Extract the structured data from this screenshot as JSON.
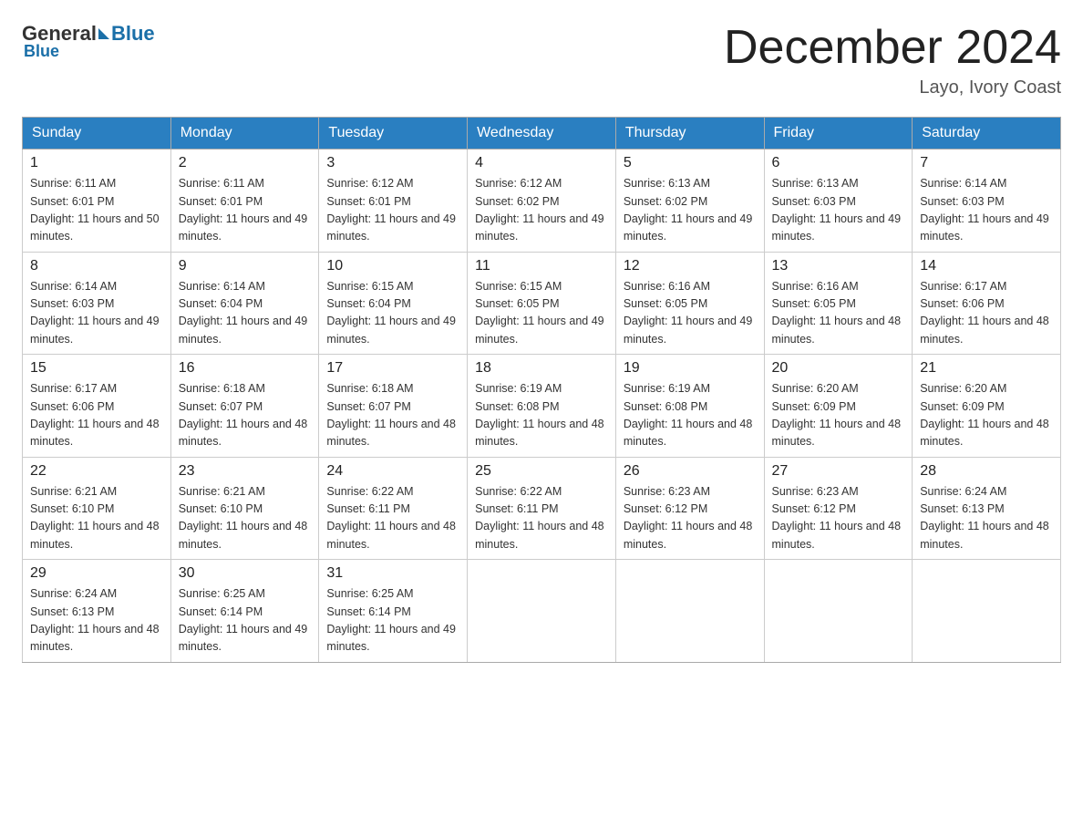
{
  "header": {
    "logo_general": "General",
    "logo_blue": "Blue",
    "month_title": "December 2024",
    "location": "Layo, Ivory Coast"
  },
  "days_of_week": [
    "Sunday",
    "Monday",
    "Tuesday",
    "Wednesday",
    "Thursday",
    "Friday",
    "Saturday"
  ],
  "weeks": [
    [
      {
        "day": "1",
        "sunrise": "6:11 AM",
        "sunset": "6:01 PM",
        "daylight": "11 hours and 50 minutes."
      },
      {
        "day": "2",
        "sunrise": "6:11 AM",
        "sunset": "6:01 PM",
        "daylight": "11 hours and 49 minutes."
      },
      {
        "day": "3",
        "sunrise": "6:12 AM",
        "sunset": "6:01 PM",
        "daylight": "11 hours and 49 minutes."
      },
      {
        "day": "4",
        "sunrise": "6:12 AM",
        "sunset": "6:02 PM",
        "daylight": "11 hours and 49 minutes."
      },
      {
        "day": "5",
        "sunrise": "6:13 AM",
        "sunset": "6:02 PM",
        "daylight": "11 hours and 49 minutes."
      },
      {
        "day": "6",
        "sunrise": "6:13 AM",
        "sunset": "6:03 PM",
        "daylight": "11 hours and 49 minutes."
      },
      {
        "day": "7",
        "sunrise": "6:14 AM",
        "sunset": "6:03 PM",
        "daylight": "11 hours and 49 minutes."
      }
    ],
    [
      {
        "day": "8",
        "sunrise": "6:14 AM",
        "sunset": "6:03 PM",
        "daylight": "11 hours and 49 minutes."
      },
      {
        "day": "9",
        "sunrise": "6:14 AM",
        "sunset": "6:04 PM",
        "daylight": "11 hours and 49 minutes."
      },
      {
        "day": "10",
        "sunrise": "6:15 AM",
        "sunset": "6:04 PM",
        "daylight": "11 hours and 49 minutes."
      },
      {
        "day": "11",
        "sunrise": "6:15 AM",
        "sunset": "6:05 PM",
        "daylight": "11 hours and 49 minutes."
      },
      {
        "day": "12",
        "sunrise": "6:16 AM",
        "sunset": "6:05 PM",
        "daylight": "11 hours and 49 minutes."
      },
      {
        "day": "13",
        "sunrise": "6:16 AM",
        "sunset": "6:05 PM",
        "daylight": "11 hours and 48 minutes."
      },
      {
        "day": "14",
        "sunrise": "6:17 AM",
        "sunset": "6:06 PM",
        "daylight": "11 hours and 48 minutes."
      }
    ],
    [
      {
        "day": "15",
        "sunrise": "6:17 AM",
        "sunset": "6:06 PM",
        "daylight": "11 hours and 48 minutes."
      },
      {
        "day": "16",
        "sunrise": "6:18 AM",
        "sunset": "6:07 PM",
        "daylight": "11 hours and 48 minutes."
      },
      {
        "day": "17",
        "sunrise": "6:18 AM",
        "sunset": "6:07 PM",
        "daylight": "11 hours and 48 minutes."
      },
      {
        "day": "18",
        "sunrise": "6:19 AM",
        "sunset": "6:08 PM",
        "daylight": "11 hours and 48 minutes."
      },
      {
        "day": "19",
        "sunrise": "6:19 AM",
        "sunset": "6:08 PM",
        "daylight": "11 hours and 48 minutes."
      },
      {
        "day": "20",
        "sunrise": "6:20 AM",
        "sunset": "6:09 PM",
        "daylight": "11 hours and 48 minutes."
      },
      {
        "day": "21",
        "sunrise": "6:20 AM",
        "sunset": "6:09 PM",
        "daylight": "11 hours and 48 minutes."
      }
    ],
    [
      {
        "day": "22",
        "sunrise": "6:21 AM",
        "sunset": "6:10 PM",
        "daylight": "11 hours and 48 minutes."
      },
      {
        "day": "23",
        "sunrise": "6:21 AM",
        "sunset": "6:10 PM",
        "daylight": "11 hours and 48 minutes."
      },
      {
        "day": "24",
        "sunrise": "6:22 AM",
        "sunset": "6:11 PM",
        "daylight": "11 hours and 48 minutes."
      },
      {
        "day": "25",
        "sunrise": "6:22 AM",
        "sunset": "6:11 PM",
        "daylight": "11 hours and 48 minutes."
      },
      {
        "day": "26",
        "sunrise": "6:23 AM",
        "sunset": "6:12 PM",
        "daylight": "11 hours and 48 minutes."
      },
      {
        "day": "27",
        "sunrise": "6:23 AM",
        "sunset": "6:12 PM",
        "daylight": "11 hours and 48 minutes."
      },
      {
        "day": "28",
        "sunrise": "6:24 AM",
        "sunset": "6:13 PM",
        "daylight": "11 hours and 48 minutes."
      }
    ],
    [
      {
        "day": "29",
        "sunrise": "6:24 AM",
        "sunset": "6:13 PM",
        "daylight": "11 hours and 48 minutes."
      },
      {
        "day": "30",
        "sunrise": "6:25 AM",
        "sunset": "6:14 PM",
        "daylight": "11 hours and 49 minutes."
      },
      {
        "day": "31",
        "sunrise": "6:25 AM",
        "sunset": "6:14 PM",
        "daylight": "11 hours and 49 minutes."
      },
      null,
      null,
      null,
      null
    ]
  ],
  "labels": {
    "sunrise_prefix": "Sunrise: ",
    "sunset_prefix": "Sunset: ",
    "daylight_prefix": "Daylight: "
  }
}
